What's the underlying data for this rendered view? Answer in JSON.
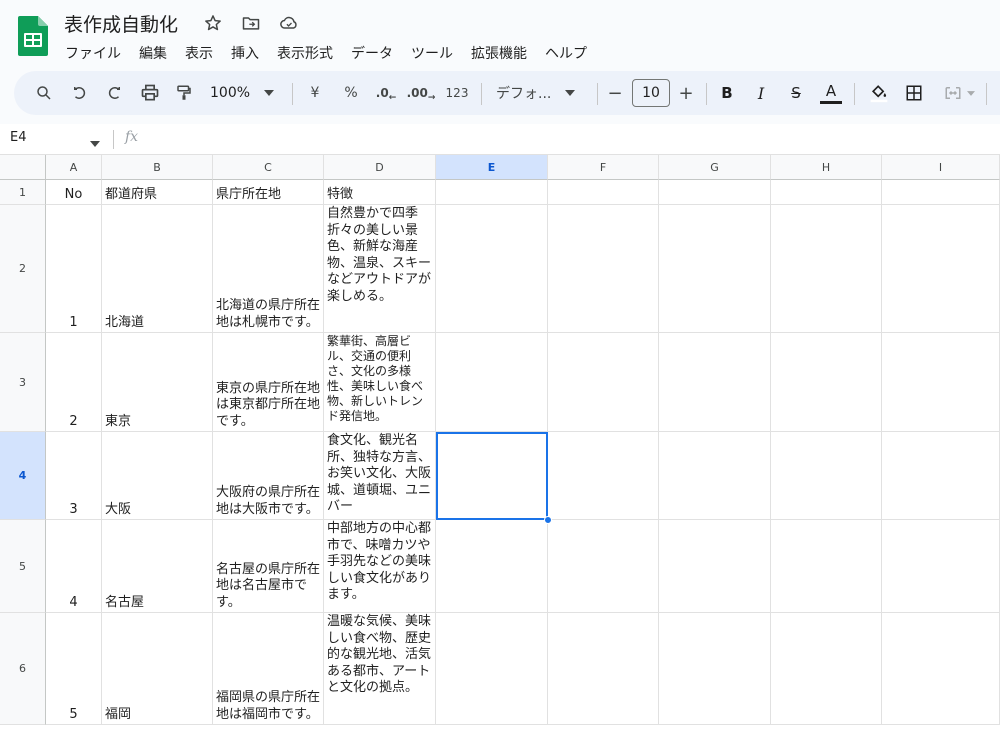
{
  "app": {
    "title": "表作成自動化",
    "menu": [
      "ファイル",
      "編集",
      "表示",
      "挿入",
      "表示形式",
      "データ",
      "ツール",
      "拡張機能",
      "ヘルプ"
    ]
  },
  "toolbar": {
    "zoom": "100%",
    "currency": "¥",
    "percent": "%",
    "dec_less": ".0",
    "dec_more": ".00",
    "number_format": "123",
    "font": "デフォ...",
    "font_size": "10",
    "minus": "−",
    "plus": "+",
    "bold": "B",
    "italic": "I",
    "strike": "S",
    "text_color": "A"
  },
  "formula_bar": {
    "name_box": "E4",
    "fx": "fx"
  },
  "colors": {
    "accent": "#1a73e8",
    "sheets_green": "#0f9d58",
    "selected_header": "#d3e3fd"
  },
  "grid": {
    "columns": [
      "A",
      "B",
      "C",
      "D",
      "E",
      "F",
      "G",
      "H",
      "I"
    ],
    "row_numbers": [
      "1",
      "2",
      "3",
      "4",
      "5",
      "6"
    ],
    "selected_cell": "E4",
    "header_row": [
      "No",
      "都道府県",
      "県庁所在地",
      "特徴"
    ],
    "rows": [
      {
        "no": "1",
        "pref": "北海道",
        "capital": "北海道の県庁所在地は札幌市です。",
        "feature": "自然豊かで四季折々の美しい景色、新鮮な海産物、温泉、スキーなどアウトドアが楽しめる。"
      },
      {
        "no": "2",
        "pref": "東京",
        "capital": "東京の県庁所在地は東京都庁所在地です。",
        "feature": "繁華街、高層ビル、交通の便利さ、文化の多様性、美味しい食べ物、新しいトレンド発信地。"
      },
      {
        "no": "3",
        "pref": "大阪",
        "capital": "大阪府の県庁所在地は大阪市です。",
        "feature": "食文化、観光名所、独特な方言、お笑い文化、大阪城、道頓堀、ユニバー"
      },
      {
        "no": "4",
        "pref": "名古屋",
        "capital": "名古屋の県庁所在地は名古屋市です。",
        "feature": "中部地方の中心都市で、味噌カツや手羽先などの美味しい食文化があります。"
      },
      {
        "no": "5",
        "pref": "福岡",
        "capital": "福岡県の県庁所在地は福岡市です。",
        "feature": "温暖な気候、美味しい食べ物、歴史的な観光地、活気ある都市、アートと文化の拠点。"
      }
    ]
  }
}
